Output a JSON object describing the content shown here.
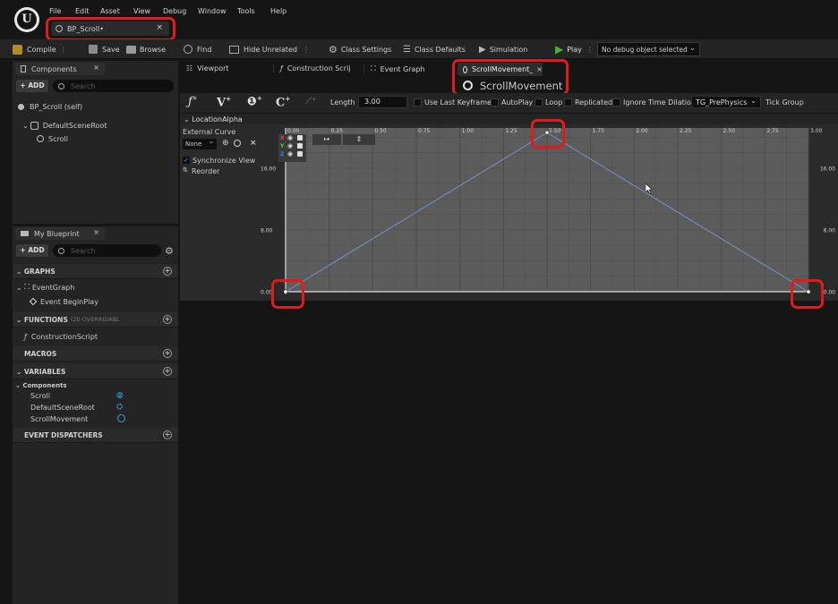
{
  "menu": [
    "File",
    "Edit",
    "Asset",
    "View",
    "Debug",
    "Window",
    "Tools",
    "Help"
  ],
  "asset_tab": {
    "label": "BP_Scroll•",
    "close": "×"
  },
  "toolbar": {
    "compile": "Compile",
    "save": "Save",
    "browse": "Browse",
    "find": "Find",
    "hide_unrelated": "Hide Unrelated",
    "class_settings": "Class Settings",
    "class_defaults": "Class Defaults",
    "simulation": "Simulation",
    "play": "Play",
    "debug_object": "No debug object selected"
  },
  "components_panel": {
    "title": "Components",
    "add": "+ ADD",
    "search_placeholder": "Search",
    "self_item": "BP_Scroll (self)",
    "root": "DefaultSceneRoot",
    "child": "Scroll"
  },
  "editor_tabs": {
    "viewport": "Viewport",
    "construction": "Construction Scrij",
    "event_graph": "Event Graph",
    "scroll_movement": "ScrollMovement_"
  },
  "tooltip": "ScrollMovement",
  "timeline_toolbar": {
    "length_label": "Length",
    "length_value": "3.00",
    "use_last_keyframe": "Use Last Keyframe",
    "autoplay": "AutoPlay",
    "loop": "Loop",
    "replicated": "Replicated",
    "ignore_time_dilation": "Ignore Time Dilation",
    "tick_group_value": "TG_PrePhysics",
    "tick_group_label": "Tick Group"
  },
  "track": {
    "name": "LocationAlpha",
    "external_curve": "External Curve",
    "none": "None",
    "sync_view": "Synchronize View",
    "reorder": "Reorder",
    "axes": [
      "X",
      "Y",
      "Z"
    ]
  },
  "my_blueprint": {
    "title": "My Blueprint",
    "add": "+ ADD",
    "search_placeholder": "Search",
    "graphs": "GRAPHS",
    "event_graph": "EventGraph",
    "begin_play": "Event BeginPlay",
    "functions": "FUNCTIONS",
    "functions_note": "(20 OVERRIDABL",
    "construction_script": "ConstructionScript",
    "macros": "MACROS",
    "variables": "VARIABLES",
    "components": "Components",
    "vars": [
      "Scroll",
      "DefaultSceneRoot",
      "ScrollMovement"
    ],
    "event_dispatchers": "EVENT DISPATCHERS"
  },
  "colors": {
    "accent_green": "#4caf33",
    "highlight_red": "#e01b1b",
    "curve": "#7c8ec6",
    "var_blue": "#3aa3e8"
  },
  "chart_data": {
    "type": "line",
    "xlabel": "",
    "ylabel": "",
    "x_ticks": [
      "0.00",
      "0.25",
      "0.50",
      "0.75",
      "1.00",
      "1.25",
      "1.50",
      "1.75",
      "2.00",
      "2.25",
      "2.50",
      "2.75",
      "3.00"
    ],
    "y_ticks": [
      "16.00",
      "8.00",
      "0.00"
    ],
    "xlim": [
      0,
      3
    ],
    "ylim": [
      0,
      21.2
    ],
    "keys": [
      {
        "x": 0,
        "y": 0
      },
      {
        "x": 1.5,
        "y": 20.6
      },
      {
        "x": 3,
        "y": 0
      }
    ]
  }
}
